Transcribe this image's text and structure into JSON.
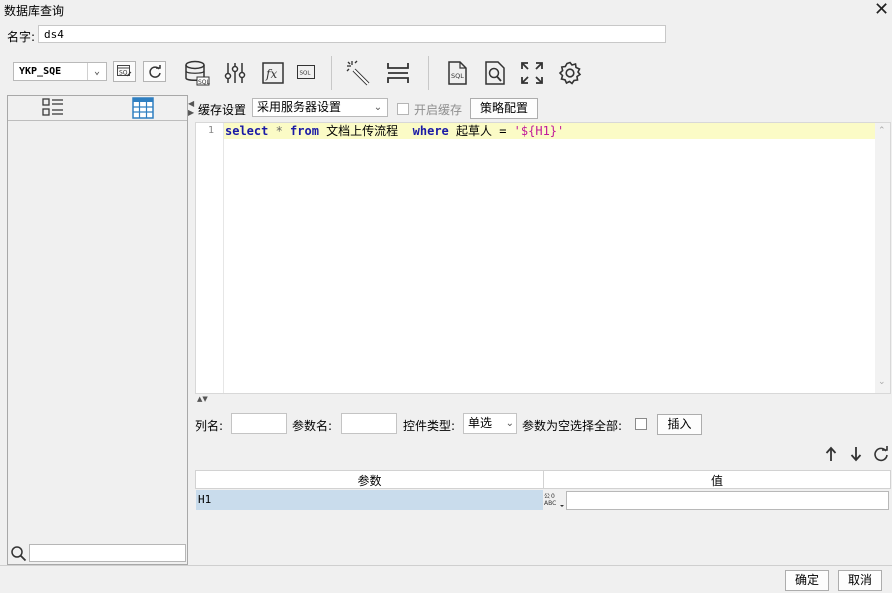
{
  "window": {
    "title": "数据库查询",
    "close_glyph": "✕"
  },
  "name_field": {
    "label": "名字:",
    "value": "ds4"
  },
  "toolbar": {
    "connection": "YKP_SQE",
    "icons": [
      "sql-param-icon",
      "refresh-icon",
      "database-sql-icon",
      "sliders-icon",
      "formula-icon",
      "sql-text-icon",
      "magic-wand-icon",
      "split-icon",
      "sql-file-icon",
      "sql-preview-icon",
      "fullscreen-icon",
      "settings-icon"
    ]
  },
  "left_panel": {
    "tabs": [
      "list-view-icon",
      "table-view-icon"
    ]
  },
  "cache": {
    "label": "缓存设置",
    "option": "采用服务器设置",
    "enable_label": "开启缓存",
    "strategy_button": "策略配置"
  },
  "editor": {
    "line_number": "1",
    "tokens": {
      "select": "select",
      "star": " * ",
      "from": "from",
      "table": " 文档上传流程  ",
      "where": "where",
      "cond": " 起草人 = ",
      "str": "'${H1}'"
    }
  },
  "param_form": {
    "column_label": "列名:",
    "param_name_label": "参数名:",
    "control_type_label": "控件类型:",
    "control_type_value": "单选",
    "select_all_label": "参数为空选择全部:",
    "insert_button": "插入"
  },
  "params_table": {
    "headers": [
      "参数",
      "值"
    ],
    "rows": [
      {
        "name": "H1",
        "value": ""
      }
    ],
    "type_icon_text": "ABC"
  },
  "footer": {
    "ok": "确定",
    "cancel": "取消"
  }
}
